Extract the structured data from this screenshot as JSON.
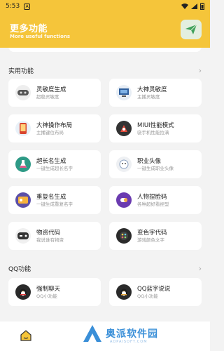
{
  "status_bar": {
    "time": "5:53",
    "badge": "A"
  },
  "header": {
    "title": "更多功能",
    "subtitle": "More useful functions"
  },
  "sections": [
    {
      "label": "实用功能",
      "items": [
        {
          "name": "灵敏度生成",
          "desc": "超稳灵敏度",
          "icon": "controller-icon"
        },
        {
          "name": "大神灵敏度",
          "desc": "主播灵敏度",
          "icon": "computer-icon"
        },
        {
          "name": "大神操作布局",
          "desc": "主播键位布局",
          "icon": "phone-layout-icon"
        },
        {
          "name": "MIUI性能模式",
          "desc": "骁手机性能拉满",
          "icon": "rocket-icon"
        },
        {
          "name": "超长名生成",
          "desc": "一键生成超长名字",
          "icon": "flask-icon"
        },
        {
          "name": "职业头像",
          "desc": "一键生成职业头像",
          "icon": "avatar-icon"
        },
        {
          "name": "重复名生成",
          "desc": "一键生成重复名字",
          "icon": "id-card-icon"
        },
        {
          "name": "人物捏脸码",
          "desc": "各种超好看捏型",
          "icon": "pill-icon"
        },
        {
          "name": "物资代码",
          "desc": "我说谁有物资",
          "icon": "gamepad-icon"
        },
        {
          "name": "变色字代码",
          "desc": "游戏颜色文字",
          "icon": "palette-icon"
        }
      ]
    },
    {
      "label": "QQ功能",
      "items": [
        {
          "name": "强制聊天",
          "desc": "QQ小功能",
          "icon": "penguin-icon"
        },
        {
          "name": "QQ蓝字说说",
          "desc": "QQ小功能",
          "icon": "penguin-icon"
        }
      ]
    }
  ],
  "watermark": {
    "text": "奥派软件园",
    "sub": "AOPAISOFT.COM"
  },
  "colors": {
    "brand": "#f5c53a",
    "card": "#ffffff",
    "background": "#f3f3f3"
  }
}
